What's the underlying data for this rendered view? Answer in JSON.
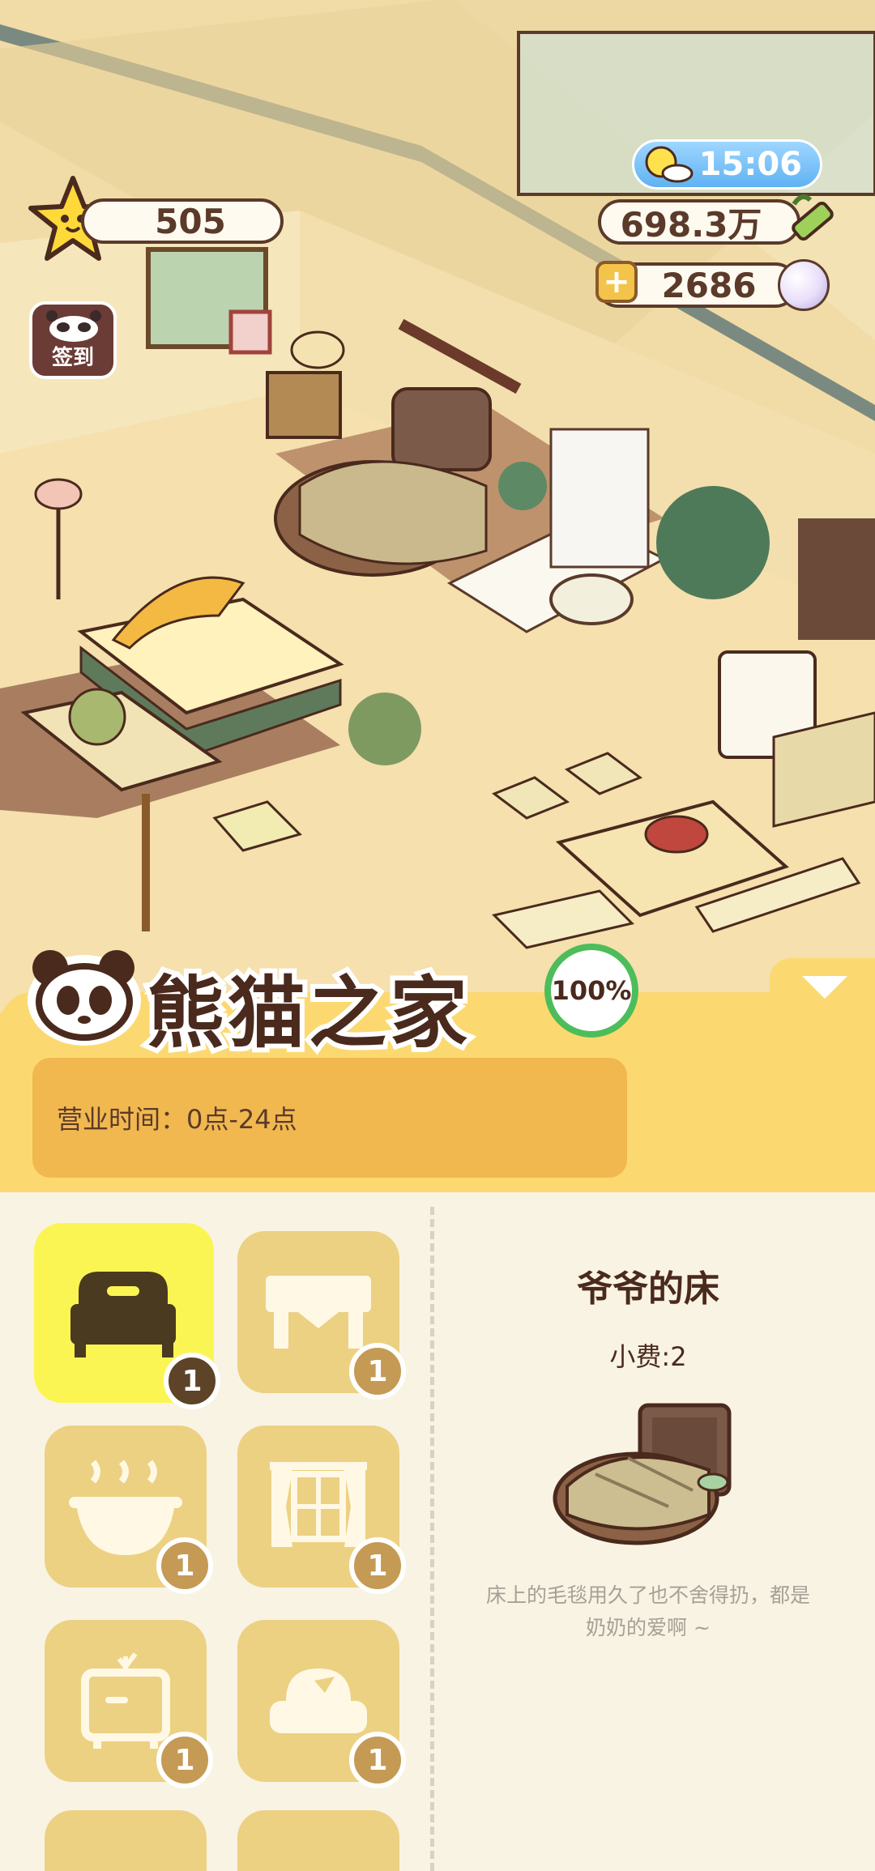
{
  "hud": {
    "stars": "505",
    "bamboo": "698.3万",
    "pearls": "2686",
    "time": "15:06",
    "signin_label": "签到"
  },
  "shop": {
    "title": "熊猫之家",
    "progress": "100%",
    "hours": "营业时间：0点-24点"
  },
  "furniture_slots": [
    {
      "icon": "bed-icon",
      "count": "1",
      "selected": true
    },
    {
      "icon": "table-icon",
      "count": "1",
      "selected": false
    },
    {
      "icon": "hot-pot-icon",
      "count": "1",
      "selected": false
    },
    {
      "icon": "window-curtain-icon",
      "count": "1",
      "selected": false
    },
    {
      "icon": "tv-cabinet-icon",
      "count": "1",
      "selected": false
    },
    {
      "icon": "sofa-icon",
      "count": "1",
      "selected": false
    }
  ],
  "detail": {
    "name": "爷爷的床",
    "tip": "小费:2",
    "description_line1": "床上的毛毯用久了也不舍得扔，都是",
    "description_line2": "奶奶的爱啊 ~"
  },
  "colors": {
    "panel_yellow": "#fcd970",
    "slot_bg": "#ecd183",
    "slot_selected": "#fbf554",
    "text_brown": "#4a2a1d",
    "progress_green": "#4dbd5b"
  }
}
